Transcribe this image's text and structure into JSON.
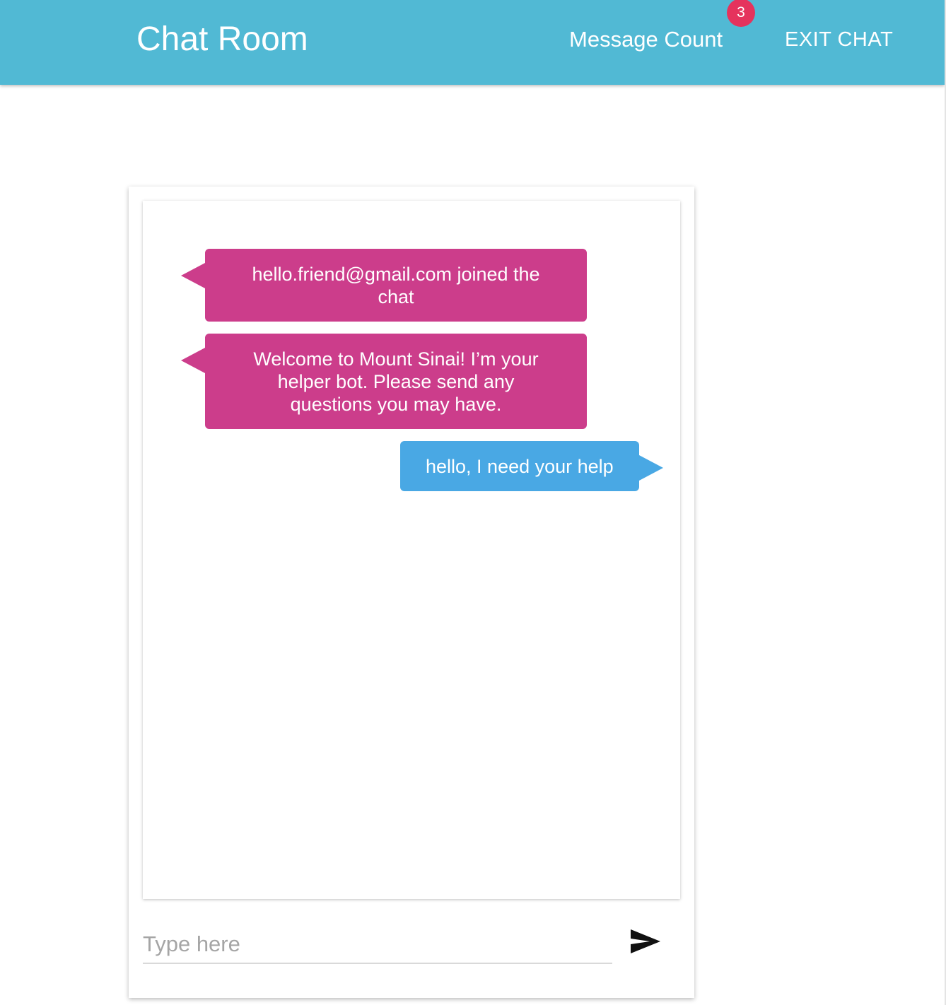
{
  "header": {
    "title": "Chat Room",
    "message_count_label": "Message Count",
    "message_count_badge": "3",
    "exit_label": "EXIT CHAT"
  },
  "messages": [
    {
      "side": "left",
      "text": "hello.friend@gmail.com joined the chat"
    },
    {
      "side": "left",
      "text": "Welcome to Mount Sinai! I’m your helper bot. Please send any questions you may have."
    },
    {
      "side": "right",
      "text": "hello, I need your help"
    }
  ],
  "composer": {
    "placeholder": "Type here",
    "send_icon": "send-icon"
  },
  "colors": {
    "appbar": "#51b9d4",
    "badge": "#e5335d",
    "incoming_bubble": "#cc3d8b",
    "outgoing_bubble": "#49a8e4"
  }
}
